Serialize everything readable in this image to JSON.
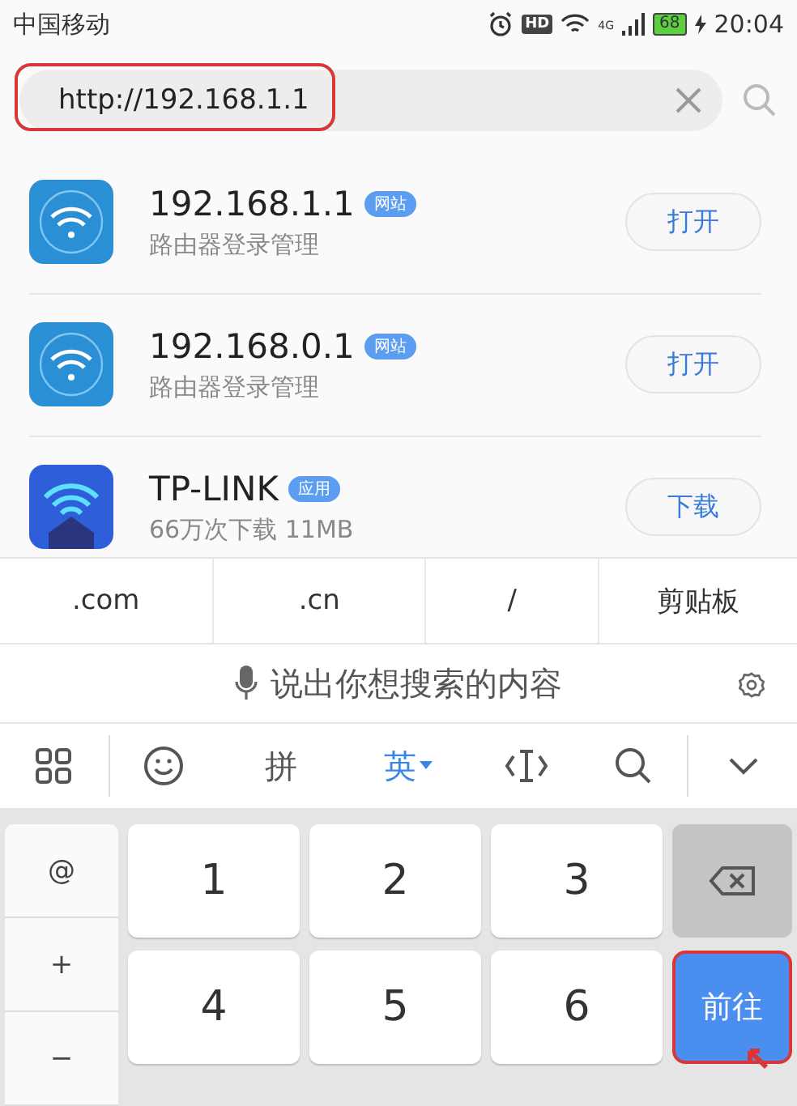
{
  "status_bar": {
    "carrier": "中国移动",
    "hd": "HD",
    "network": "4G",
    "battery": "68",
    "time": "20:04"
  },
  "search": {
    "value": "http://192.168.1.1",
    "highlighted": true
  },
  "results": [
    {
      "kind": "router",
      "title": "192.168.1.1",
      "tag": "网站",
      "subtitle": "路由器登录管理",
      "action": "打开"
    },
    {
      "kind": "router",
      "title": "192.168.0.1",
      "tag": "网站",
      "subtitle": "路由器登录管理",
      "action": "打开"
    },
    {
      "kind": "app",
      "title": "TP-LINK",
      "tag": "应用",
      "subtitle": "66万次下载 11MB",
      "action": "下载"
    }
  ],
  "shortcuts": [
    ".com",
    ".cn",
    "/",
    "剪贴板"
  ],
  "voice_hint": "说出你想搜索的内容",
  "toolbar": [
    {
      "kind": "grid"
    },
    {
      "kind": "emoji"
    },
    {
      "kind": "text",
      "label": "拼",
      "selected": false
    },
    {
      "kind": "text",
      "label": "英",
      "selected": true
    },
    {
      "kind": "cursor"
    },
    {
      "kind": "search"
    },
    {
      "kind": "collapse"
    }
  ],
  "keypad": {
    "side": [
      "@",
      "+",
      "−"
    ],
    "digits": [
      "1",
      "2",
      "3",
      "4",
      "5",
      "6"
    ],
    "go": {
      "label": "前往",
      "highlighted": true
    }
  }
}
